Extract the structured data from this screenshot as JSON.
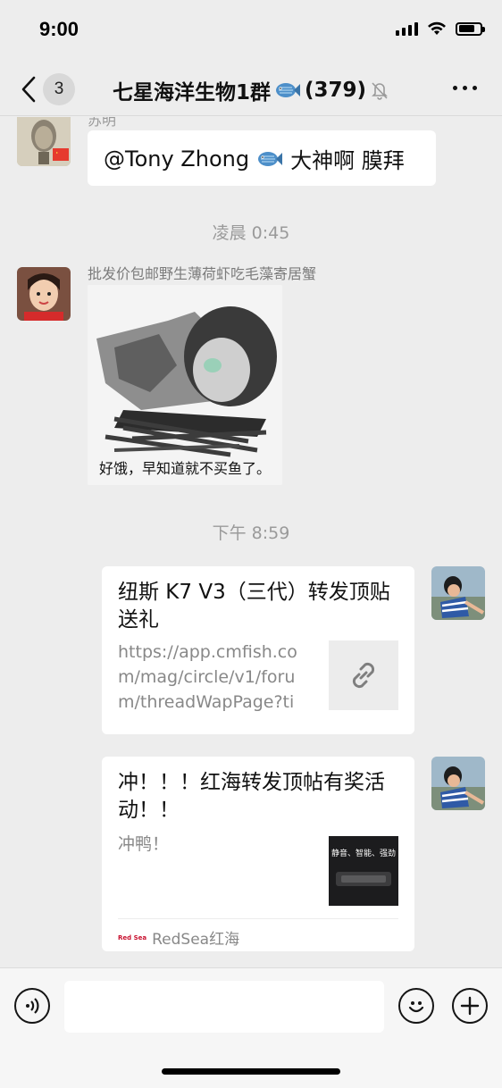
{
  "status_bar": {
    "time": "9:00"
  },
  "nav": {
    "back_count": "3",
    "title": "七星海洋生物1群",
    "member_count": "(379)"
  },
  "messages": {
    "first": {
      "sender_partial": "苏明",
      "text_prefix": "@Tony Zhong",
      "text_suffix": "大神啊  膜拜"
    },
    "divider1": "凌晨 0:45",
    "second": {
      "sender": "批发价包邮野生薄荷虾吃毛藻寄居蟹",
      "sticker_caption": "好饿，早知道就不买鱼了。"
    },
    "divider2": "下午 8:59",
    "card1": {
      "title": "纽斯 K7 V3（三代）转发顶贴送礼",
      "url": "https://app.cmfish.com/mag/circle/v1/forum/threadWapPage?tid..."
    },
    "card2": {
      "title": "冲！！！红海转发顶帖有奖活动！！",
      "desc": "冲鸭！",
      "thumb_text": "静音、智能、强劲",
      "source_logo": "Red Sea",
      "source": "RedSea红海"
    }
  },
  "colors": {
    "background": "#ededed",
    "bubble": "#ffffff",
    "muted_text": "#888888"
  }
}
